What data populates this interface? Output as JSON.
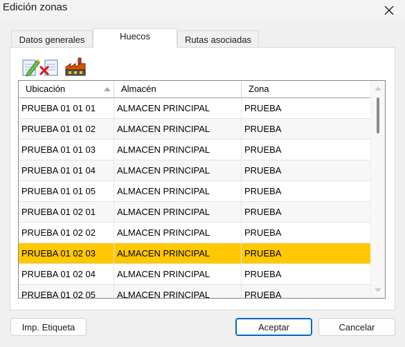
{
  "window": {
    "title": "Edición zonas",
    "close_icon": "close-icon"
  },
  "tabs": [
    {
      "label": "Datos generales",
      "active": false
    },
    {
      "label": "Huecos",
      "active": true
    },
    {
      "label": "Rutas asociadas",
      "active": false
    }
  ],
  "toolbar": {
    "items": [
      {
        "icon": "edit-document-icon"
      },
      {
        "icon": "delete-document-icon"
      },
      {
        "icon": "warehouse-icon"
      }
    ]
  },
  "grid": {
    "columns": [
      {
        "label": "Ubicación",
        "sorted": "asc"
      },
      {
        "label": "Almacén"
      },
      {
        "label": "Zona"
      }
    ],
    "rows": [
      {
        "ubicacion": "PRUEBA 01 01 01",
        "almacen": "ALMACEN PRINCIPAL",
        "zona": "PRUEBA"
      },
      {
        "ubicacion": "PRUEBA 01 01 02",
        "almacen": "ALMACEN PRINCIPAL",
        "zona": "PRUEBA"
      },
      {
        "ubicacion": "PRUEBA 01 01 03",
        "almacen": "ALMACEN PRINCIPAL",
        "zona": "PRUEBA"
      },
      {
        "ubicacion": "PRUEBA 01 01 04",
        "almacen": "ALMACEN PRINCIPAL",
        "zona": "PRUEBA"
      },
      {
        "ubicacion": "PRUEBA 01 01 05",
        "almacen": "ALMACEN PRINCIPAL",
        "zona": "PRUEBA"
      },
      {
        "ubicacion": "PRUEBA 01 02 01",
        "almacen": "ALMACEN PRINCIPAL",
        "zona": "PRUEBA"
      },
      {
        "ubicacion": "PRUEBA 01 02 02",
        "almacen": "ALMACEN PRINCIPAL",
        "zona": "PRUEBA"
      },
      {
        "ubicacion": "PRUEBA 01 02 03",
        "almacen": "ALMACEN PRINCIPAL",
        "zona": "PRUEBA"
      },
      {
        "ubicacion": "PRUEBA 01 02 04",
        "almacen": "ALMACEN PRINCIPAL",
        "zona": "PRUEBA"
      },
      {
        "ubicacion": "PRUEBA 01 02 05",
        "almacen": "ALMACEN PRINCIPAL",
        "zona": "PRUEBA"
      }
    ],
    "selected_row": "PRUEBA 01 02 03",
    "selection_color": "#ffc800"
  },
  "footer": {
    "print_label": "Imp. Etiqueta",
    "accept_label": "Aceptar",
    "cancel_label": "Cancelar"
  },
  "colors": {
    "accent": "#0067c0",
    "selection": "#ffc800"
  }
}
